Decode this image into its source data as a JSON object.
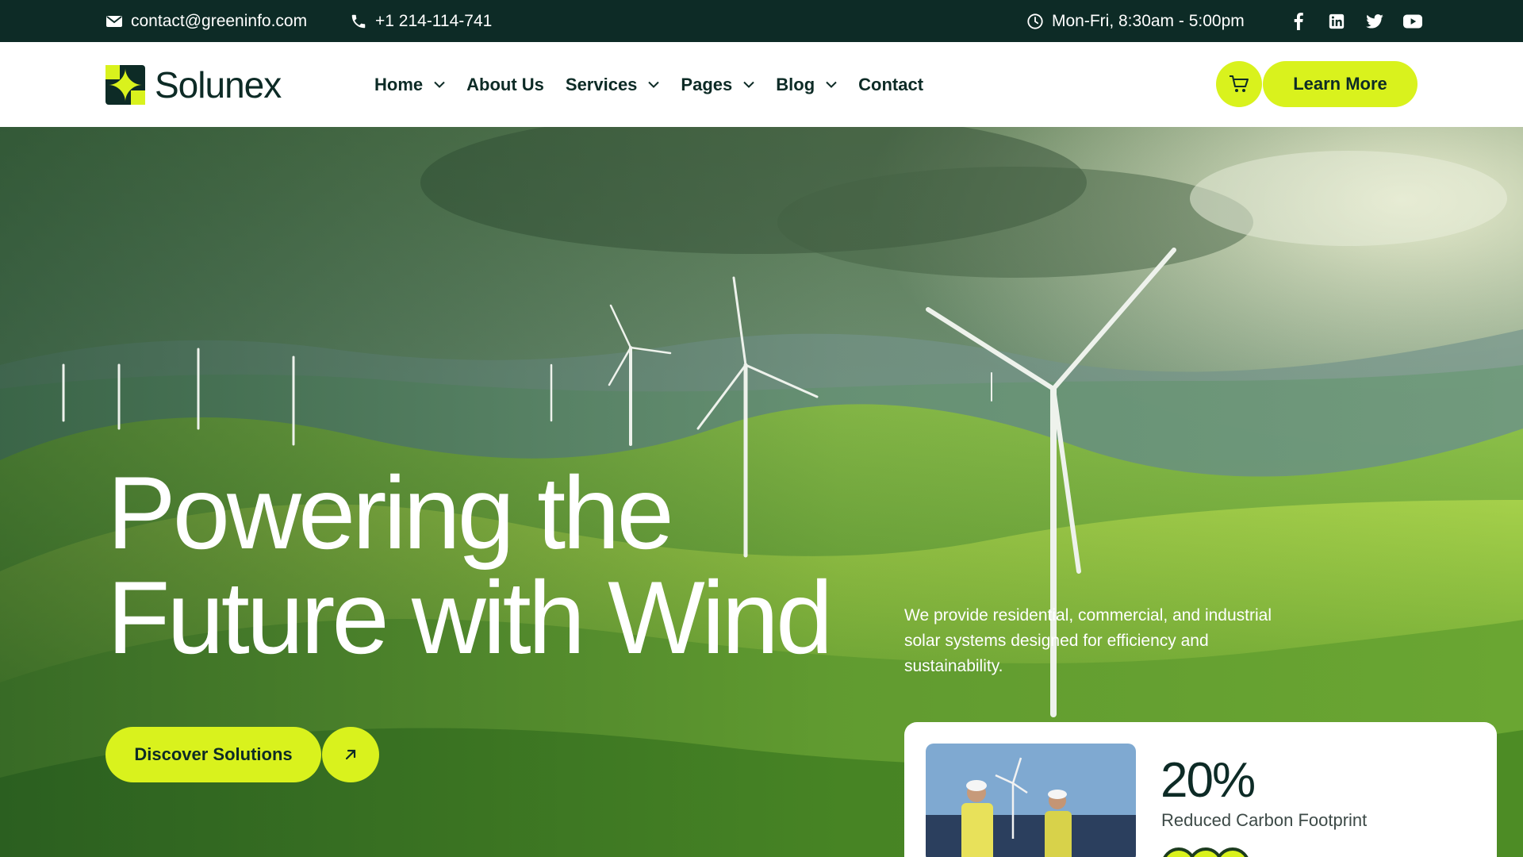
{
  "topbar": {
    "email": "contact@greeninfo.com",
    "phone": "+1 214-114-741",
    "hours": "Mon-Fri, 8:30am - 5:00pm",
    "social_icons": [
      "facebook-icon",
      "linkedin-icon",
      "twitter-icon",
      "youtube-icon"
    ]
  },
  "header": {
    "logo_text": "Solunex",
    "nav": [
      {
        "label": "Home",
        "has_dropdown": true
      },
      {
        "label": "About Us",
        "has_dropdown": false
      },
      {
        "label": "Services",
        "has_dropdown": true
      },
      {
        "label": "Pages",
        "has_dropdown": true
      },
      {
        "label": "Blog",
        "has_dropdown": true
      },
      {
        "label": "Contact",
        "has_dropdown": false
      }
    ],
    "cta_label": "Learn More"
  },
  "hero": {
    "title_line1": "Powering the",
    "title_line2": "Future with Wind",
    "description": "We provide residential, commercial, and industrial solar systems designed for efficiency and sustainability.",
    "primary_button": "Discover Solutions"
  },
  "stat_card": {
    "value": "20%",
    "label": "Reduced Carbon Footprint"
  },
  "colors": {
    "accent": "#d9f21d",
    "dark": "#0d2b26",
    "hero_green": "#4f8f2a"
  }
}
